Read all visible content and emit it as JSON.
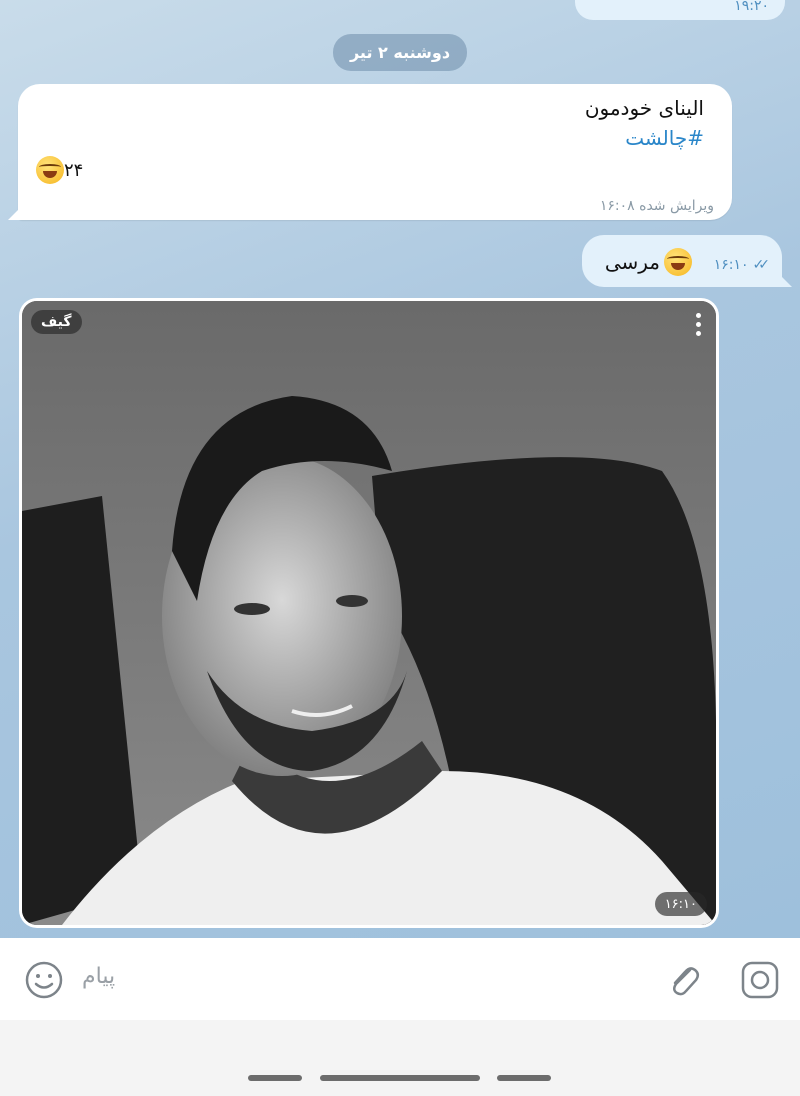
{
  "top_partial": {
    "time": "۱۹:۲۰"
  },
  "date_divider": "دوشنبه ۲ تیر",
  "incoming_message": {
    "line1": "الینای خودمون",
    "hashtag": "#چالشت",
    "count": "۲۴",
    "meta": "ویرایش شده ۱۶:۰۸"
  },
  "outgoing_message": {
    "text": "مرسی",
    "time": "۱۶:۱۰"
  },
  "gif_message": {
    "badge": "گیف",
    "time": "۱۶:۱۰"
  },
  "input": {
    "placeholder": "پیام"
  },
  "colors": {
    "accent": "#4f8fc0",
    "link": "#2a86c9",
    "outgoing_bubble": "#e3f1fb"
  }
}
